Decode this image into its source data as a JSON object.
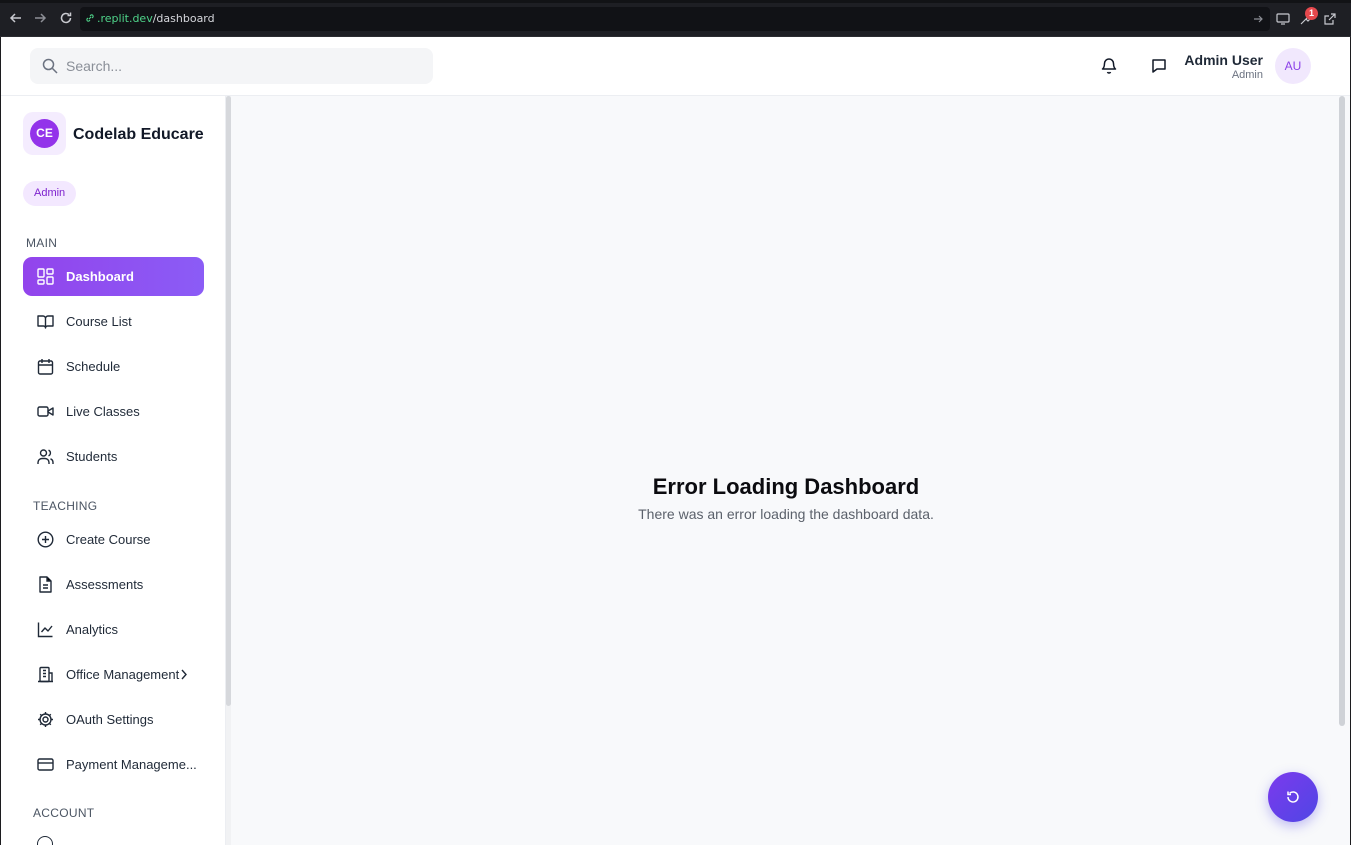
{
  "browser": {
    "url_domain": ".replit.dev",
    "url_path": "/dashboard",
    "notification_count": "1"
  },
  "topbar": {
    "search_placeholder": "Search...",
    "user_name": "Admin User",
    "user_role": "Admin",
    "avatar_initials": "AU"
  },
  "sidebar": {
    "brand_initials": "CE",
    "brand_name": "Codelab Educare",
    "role": "Admin",
    "sections": {
      "main": "MAIN",
      "teaching": "TEACHING",
      "account": "ACCOUNT"
    },
    "items": [
      {
        "label": "Dashboard",
        "icon": "dashboard-icon",
        "active": true
      },
      {
        "label": "Course List",
        "icon": "book-icon"
      },
      {
        "label": "Schedule",
        "icon": "calendar-icon"
      },
      {
        "label": "Live Classes",
        "icon": "video-icon"
      },
      {
        "label": "Students",
        "icon": "users-icon"
      },
      {
        "label": "Create Course",
        "icon": "plus-circle-icon"
      },
      {
        "label": "Assessments",
        "icon": "document-icon"
      },
      {
        "label": "Analytics",
        "icon": "chart-line-icon"
      },
      {
        "label": "Office Management",
        "icon": "building-icon"
      },
      {
        "label": "OAuth Settings",
        "icon": "gear-icon"
      },
      {
        "label": "Payment Manageme...",
        "icon": "credit-card-icon"
      }
    ]
  },
  "main": {
    "error_title": "Error Loading Dashboard",
    "error_message": "There was an error loading the dashboard data."
  },
  "colors": {
    "accent": "#9333ea",
    "active_nav": "#9244ec",
    "fab": "#6d3fe9"
  }
}
